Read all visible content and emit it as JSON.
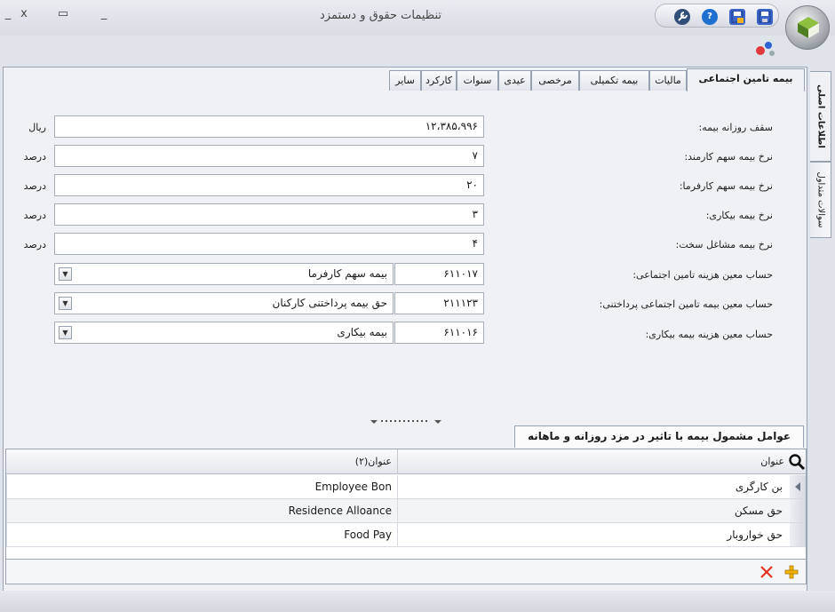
{
  "window": {
    "title": "تنظیمات حقوق و دستمزد",
    "controls": {
      "close": "x",
      "restore": "▭",
      "minimize": "_"
    }
  },
  "quick_access": {
    "icons": [
      "wrench-icon",
      "help-icon",
      "save-as-icon",
      "save-icon"
    ],
    "help_label": "?"
  },
  "side_tabs": [
    {
      "label": "اطلاعات اصلی",
      "active": true
    },
    {
      "label": "سوالات متداول",
      "active": false
    }
  ],
  "tabs": [
    {
      "label": "بیمه تامین اجتماعی",
      "active": true
    },
    {
      "label": "مالیات",
      "active": false
    },
    {
      "label": "بیمه تکمیلی",
      "active": false
    },
    {
      "label": "مرخصی",
      "active": false
    },
    {
      "label": "عیدی",
      "active": false
    },
    {
      "label": "سنوات",
      "active": false
    },
    {
      "label": "کارکرد",
      "active": false
    },
    {
      "label": "سایر",
      "active": false
    }
  ],
  "form": {
    "rate_fields": [
      {
        "label": "سقف روزانه بیمه:",
        "value": "۱۲،۳۸۵،۹۹۶",
        "unit": "ریال"
      },
      {
        "label": "نرخ بیمه سهم کارمند:",
        "value": "۷",
        "unit": "درصد"
      },
      {
        "label": "نرخ بیمه سهم کارفرما:",
        "value": "۲۰",
        "unit": "درصد"
      },
      {
        "label": "نرخ بیمه بیکاری:",
        "value": "۳",
        "unit": "درصد"
      },
      {
        "label": "نرخ بیمه مشاغل سخت:",
        "value": "۴",
        "unit": "درصد"
      }
    ],
    "account_fields": [
      {
        "label": "حساب معین هزینه تامین اجتماعی:",
        "code": "۶۱۱۰۱۷",
        "name": "بیمه سهم کارفرما"
      },
      {
        "label": "حساب معین بیمه تامین اجتماعی پرداختنی:",
        "code": "۲۱۱۱۲۳",
        "name": "حق بیمه پرداختنی کارکنان"
      },
      {
        "label": "حساب معین هزینه بیمه بیکاری:",
        "code": "۶۱۱۰۱۶",
        "name": "بیمه بیکاری"
      }
    ]
  },
  "grid_section": {
    "tab_label": "عوامل مشمول بیمه با تاثیر در مزد روزانه و ماهانه",
    "columns": [
      "عنوان",
      "عنوان(۲)"
    ],
    "rows": [
      {
        "title": "بن کارگری",
        "title2": "Employee Bon"
      },
      {
        "title": "حق مسکن",
        "title2": "Residence Alloance"
      },
      {
        "title": "حق خواروبار",
        "title2": "Food Pay"
      }
    ]
  }
}
